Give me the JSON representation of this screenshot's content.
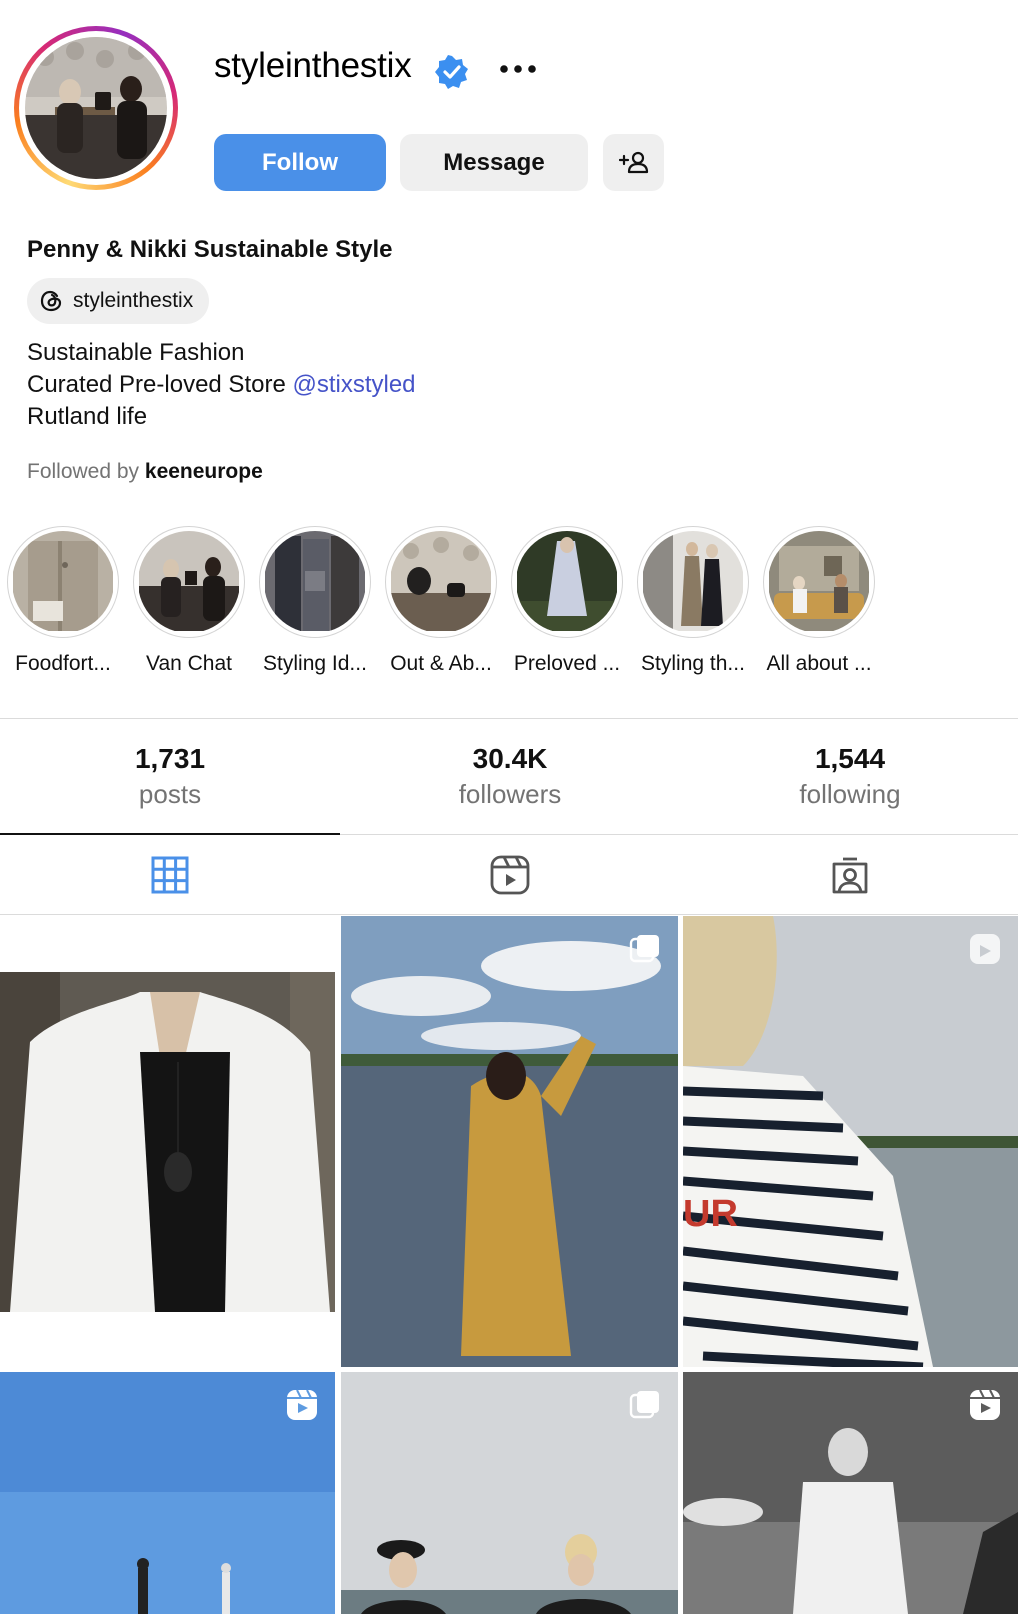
{
  "profile": {
    "username": "styleinthestix",
    "full_name": "Penny & Nikki Sustainable Style",
    "threads_handle": "styleinthestix",
    "bio": {
      "line1": "Sustainable Fashion",
      "line2_text": "Curated Pre-loved Store ",
      "line2_mention": "@stixstyled",
      "line3": "Rutland life"
    },
    "followed_by_prefix": "Followed by ",
    "followed_by_user": "keeneurope"
  },
  "actions": {
    "follow_label": "Follow",
    "message_label": "Message"
  },
  "highlights": [
    {
      "label": "Foodfort..."
    },
    {
      "label": "Van Chat"
    },
    {
      "label": "Styling Id..."
    },
    {
      "label": "Out & Ab..."
    },
    {
      "label": "Preloved ..."
    },
    {
      "label": "Styling th..."
    },
    {
      "label": "All about ..."
    }
  ],
  "stats": {
    "posts": {
      "value": "1,731",
      "label": "posts"
    },
    "followers": {
      "value": "30.4K",
      "label": "followers"
    },
    "following": {
      "value": "1,544",
      "label": "following"
    }
  },
  "tabs": [
    {
      "name": "posts-grid",
      "icon": "grid-icon",
      "active": true
    },
    {
      "name": "reels",
      "icon": "reels-icon",
      "active": false
    },
    {
      "name": "tagged",
      "icon": "tagged-icon",
      "active": false
    }
  ],
  "colors": {
    "accent": "#4a90e8",
    "mention": "#4553c8",
    "verified": "#3b8ff0"
  }
}
